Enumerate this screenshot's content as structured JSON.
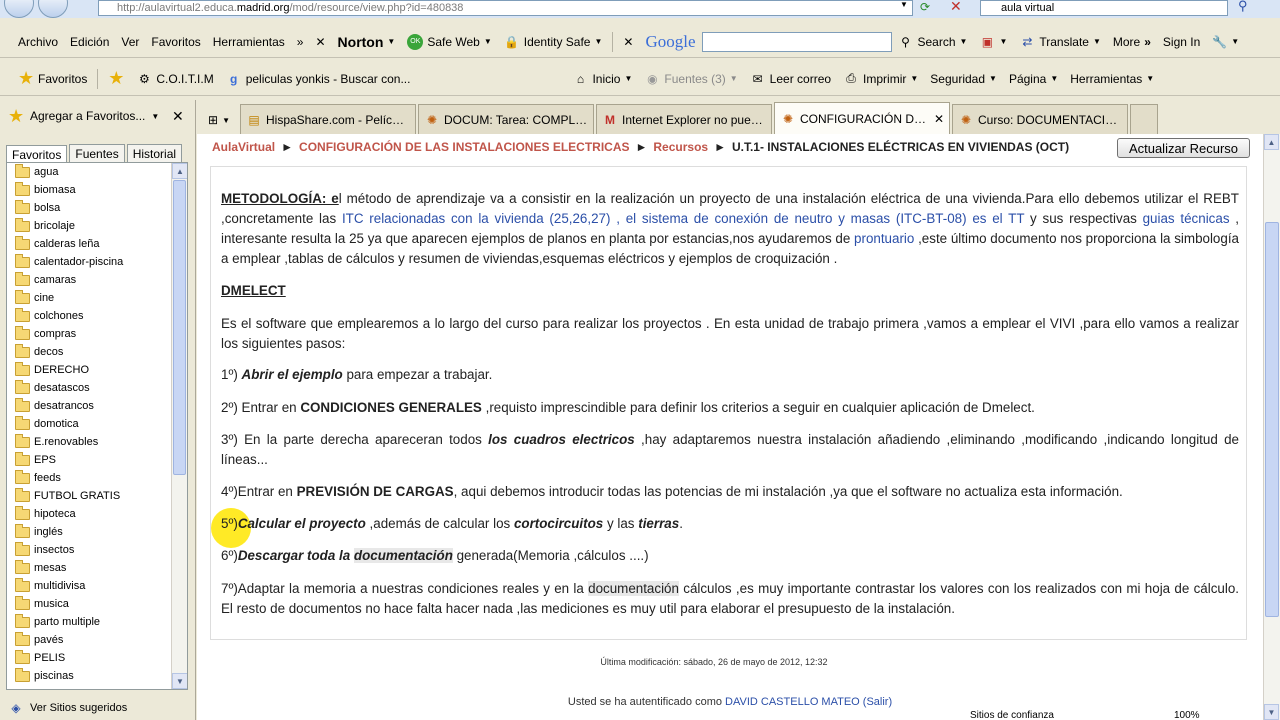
{
  "address": {
    "url_prefix": "http://aulavirtual2.educa.",
    "url_host": "madrid.org",
    "url_rest": "/mod/resource/view.php?id=480838",
    "search_value": "aula virtual"
  },
  "menu": {
    "items": [
      "Archivo",
      "Edición",
      "Ver",
      "Favoritos",
      "Herramientas"
    ],
    "norton": "Norton",
    "safeweb": "Safe Web",
    "identity": "Identity Safe",
    "google": "Google",
    "search": "Search",
    "translate": "Translate",
    "more": "More",
    "more_arrows": "»",
    "signin": "Sign In"
  },
  "favbar": {
    "favoritos": "Favoritos",
    "coitim": "C.O.I.T.I.M",
    "peliculas": "peliculas yonkis - Buscar con...",
    "inicio": "Inicio",
    "fuentes": "Fuentes (3)",
    "correo": "Leer correo",
    "imprimir": "Imprimir",
    "seguridad": "Seguridad",
    "pagina": "Página",
    "herramientas": "Herramientas"
  },
  "panel": {
    "add_fav": "Agregar a Favoritos...",
    "tabs": [
      "Favoritos",
      "Fuentes",
      "Historial"
    ],
    "folders": [
      "agua",
      "biomasa",
      "bolsa",
      "bricolaje",
      "calderas leña",
      "calentador-piscina",
      "camaras",
      "cine",
      "colchones",
      "compras",
      "decos",
      "DERECHO",
      "desatascos",
      "desatrancos",
      "domotica",
      "E.renovables",
      "EPS",
      "feeds",
      "FUTBOL GRATIS",
      "hipoteca",
      "inglés",
      "insectos",
      "mesas",
      "multidivisa",
      "musica",
      "parto multiple",
      "pavés",
      "PELIS",
      "piscinas"
    ],
    "sugeridos": "Ver Sitios sugeridos"
  },
  "tabs": [
    {
      "label": "HispaShare.com - Película \"Vi..."
    },
    {
      "label": "DOCUM: Tarea: COMPLETAR..."
    },
    {
      "label": "Internet Explorer no puede ..."
    },
    {
      "label": "CONFIGURACIÓN DE LAS..."
    },
    {
      "label": "Curso: DOCUMENTACIÓN DE..."
    }
  ],
  "page": {
    "breadcrumb": [
      "AulaVirtual",
      "CONFIGURACIÓN DE LAS INSTALACIONES ELECTRICAS",
      "Recursos",
      "U.T.1- INSTALACIONES ELÉCTRICAS EN VIVIENDAS (OCT)"
    ],
    "update_button": "Actualizar Recurso",
    "p1": {
      "h": "METODOLOGÍA: e",
      "a": "l método de aprendizaje va a consistir en la realización un proyecto de una instalación eléctrica de una vivienda.Para ello debemos utilizar el REBT ,concretamente las ",
      "l1": "ITC relacionadas con la vivienda (25,26,27)",
      "b": " , ",
      "l2": "el sistema de conexión de neutro y masas (ITC-BT-08) es el TT",
      "c": " y sus respectivas ",
      "l3": "guias técnicas",
      "d": " , interesante resulta la 25 ya que aparecen ejemplos de planos en planta por estancias,nos ayudaremos de ",
      "l4": "prontuario",
      "e": " ,este último documento nos proporciona la simbología a emplear ,tablas de cálculos y resumen de viviendas,esquemas eléctricos y ejemplos de croquización ."
    },
    "dmelect": "DMELECT",
    "p2": "Es el software que emplearemos a lo largo del curso para realizar los proyectos . En esta unidad de trabajo primera ,vamos a emplear el VIVI ,para ello vamos a realizar los siguientes pasos:",
    "s1": {
      "n": "1º) ",
      "b": "Abrir el ejemplo",
      "t": " para empezar a trabajar."
    },
    "s2": {
      "n": "2º) Entrar en ",
      "b": "CONDICIONES GENERALES",
      "t": " ,requisto imprescindible para definir los criterios a seguir en cualquier aplicación de Dmelect."
    },
    "s3": {
      "n": "3º) En la parte derecha apareceran todos ",
      "b": "los cuadros electricos",
      "t": "  ,hay adaptaremos nuestra instalación añadiendo ,eliminando ,modificando ,indicando longitud de líneas..."
    },
    "s4": {
      "n": "4º)Entrar en ",
      "b": "PREVISIÓN DE CARGAS",
      "t": ", aqui debemos introducir todas las potencias de mi instalación ,ya que el software no actualiza esta información."
    },
    "s5": {
      "n": "5º)",
      "b1": "Calcular el proyecto",
      "t1": " ,además de calcular los ",
      "b2": "cortocircuitos",
      "t2": " y las ",
      "b3": "tierras",
      "t3": "."
    },
    "s6": {
      "n": "6º)",
      "b1": "Descargar toda la ",
      "b2": "documentación",
      "t": " generada(Memoria ,cálculos ....)"
    },
    "s7": {
      "a": "7º)Adaptar la memoria a nuestras condiciones reales y en la ",
      "h": "documentación",
      "b": " cálculos ,es muy importante contrastar los valores con los realizados con mi hoja de cálculo. El resto de documentos no hace falta hacer nada ,las mediciones es muy util para elaborar el presupuesto de la instalación."
    },
    "modified": "Última modificación: sábado, 26 de mayo de 2012, 12:32",
    "auth_prefix": "Usted se ha autentificado como ",
    "auth_user": "DAVID CASTELLO MATEO (Salir)"
  },
  "status": {
    "zone": "Sitios de confianza",
    "zoom": "100%"
  }
}
